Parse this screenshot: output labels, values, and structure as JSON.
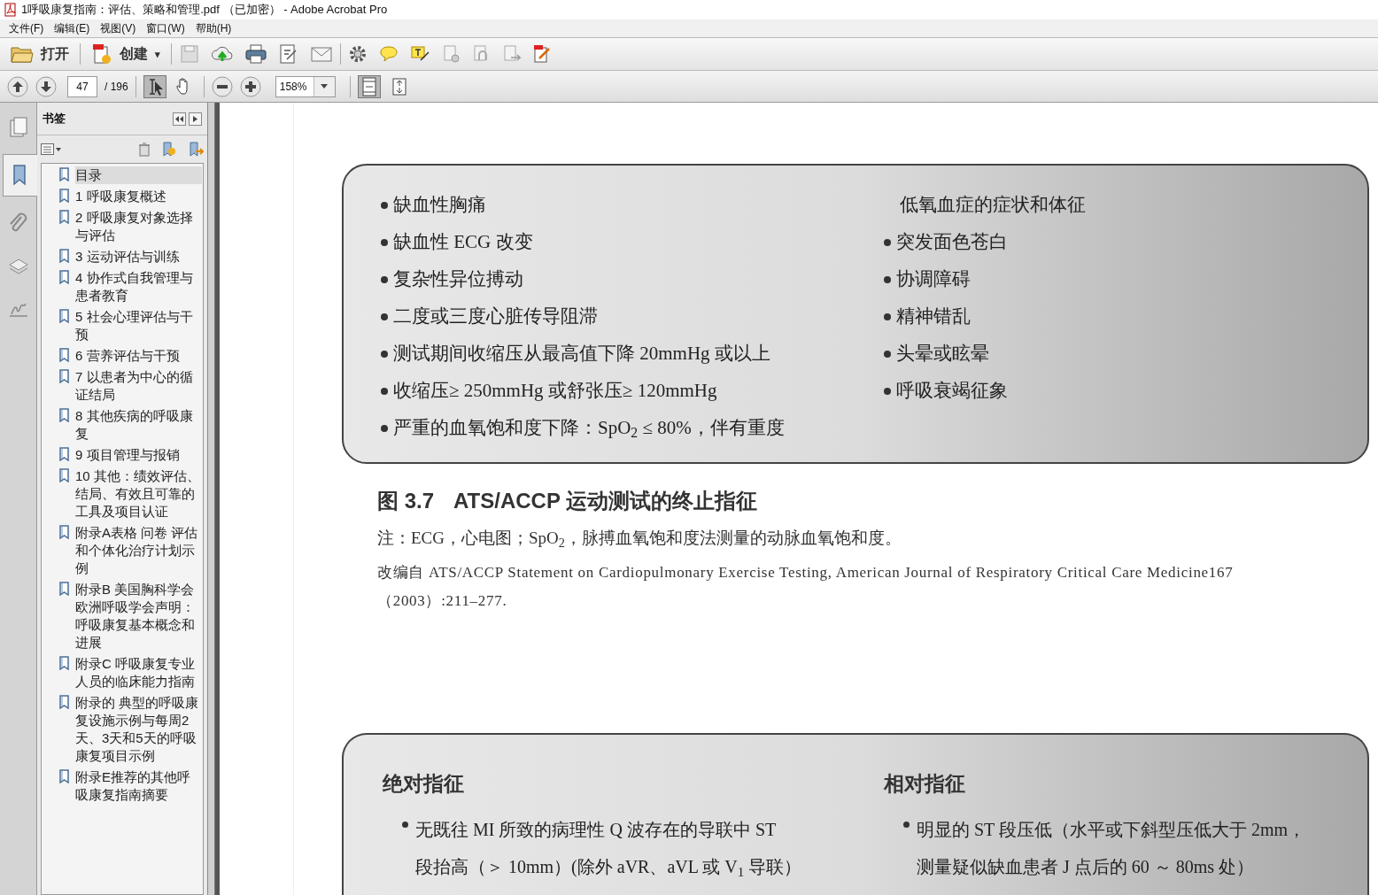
{
  "window": {
    "title": "1呼吸康复指南：评估、策略和管理.pdf （已加密） - Adobe Acrobat Pro"
  },
  "menu": [
    "文件(F)",
    "编辑(E)",
    "视图(V)",
    "窗口(W)",
    "帮助(H)"
  ],
  "toolbar": {
    "open_label": "打开",
    "create_label": "创建",
    "create_caret": "▾"
  },
  "navigation": {
    "page_value": "47",
    "page_total": "/ 196",
    "zoom_value": "158%",
    "tools": [
      {
        "kind": "select",
        "selected": true
      },
      {
        "kind": "hand",
        "selected": false
      }
    ],
    "view_buttons": [
      {
        "kind": "fit-page",
        "selected": true
      },
      {
        "kind": "fit-width",
        "selected": false
      }
    ]
  },
  "side_tabs": [
    {
      "kind": "pages",
      "selected": false
    },
    {
      "kind": "bookmarks",
      "selected": true
    },
    {
      "kind": "attachments",
      "selected": false
    },
    {
      "kind": "layers",
      "selected": false
    },
    {
      "kind": "signatures",
      "selected": false
    }
  ],
  "bookmarks_panel": {
    "title": "书签",
    "items": [
      {
        "label": "目录",
        "selected": true
      },
      {
        "label": "1 呼吸康复概述",
        "selected": false
      },
      {
        "label": "2 呼吸康复对象选择与评估",
        "selected": false
      },
      {
        "label": "3 运动评估与训练",
        "selected": false
      },
      {
        "label": "4 协作式自我管理与患者教育",
        "selected": false
      },
      {
        "label": "5 社会心理评估与干预",
        "selected": false
      },
      {
        "label": "6 营养评估与干预",
        "selected": false
      },
      {
        "label": "7  以患者为中心的循证结局",
        "selected": false
      },
      {
        "label": "8 其他疾病的呼吸康复",
        "selected": false
      },
      {
        "label": "9 项目管理与报销",
        "selected": false
      },
      {
        "label": "10 其他：绩效评估、结局、有效且可靠的工具及项目认证",
        "selected": false
      },
      {
        "label": "附录A表格 问卷 评估和个体化治疗计划示例",
        "selected": false
      },
      {
        "label": "附录B 美国胸科学会欧洲呼吸学会声明：呼吸康复基本概念和进展",
        "selected": false
      },
      {
        "label": "附录C 呼吸康复专业人员的临床能力指南",
        "selected": false
      },
      {
        "label": "附录的 典型的呼吸康复设施示例与每周2天、3天和5天的呼吸康复项目示例",
        "selected": false
      },
      {
        "label": "附录E推荐的其他呼吸康复指南摘要",
        "selected": false
      }
    ]
  },
  "document": {
    "figure_box": {
      "left_items": [
        "缺血性胸痛",
        "缺血性 ECG 改变",
        "复杂性异位搏动",
        "二度或三度心脏传导阻滞",
        "测试期间收缩压从最高值下降 20mmHg 或以上",
        " 收缩压≥ 250mmHg 或舒张压≥ 120mmHg",
        "严重的血氧饱和度下降：SpO$_{2}$ ≤ 80%，伴有重度"
      ],
      "right_heading": "低氧血症的症状和体征",
      "right_items": [
        "突发面色苍白",
        "协调障碍",
        "精神错乱",
        "头晕或眩晕",
        "呼吸衰竭征象"
      ]
    },
    "caption_number": "图 3.7",
    "caption_title": "ATS/ACCP 运动测试的终止指征",
    "note": "注：ECG，心电图；SpO$_{2}$，脉搏血氧饱和度法测量的动脉血氧饱和度。",
    "source": "改编自 ATS/ACCP Statement on Cardiopulmonary Exercise Testing, American Journal of Respiratory Critical Care Medicine167（2003）:211–277.",
    "second_box": {
      "left_heading": "绝对指征",
      "left_item_lines": [
        "无既往 MI 所致的病理性 Q 波存在的导联中 ST",
        "段抬高（＞ 10mm）(除外 aVR、aVL 或 V$_{1}$ 导联）"
      ],
      "right_heading": "相对指征",
      "right_item_lines": [
        "明显的 ST 段压低（水平或下斜型压低大于 2mm，",
        "测量疑似缺血患者 J 点后的 60 ～ 80ms 处）"
      ]
    }
  }
}
